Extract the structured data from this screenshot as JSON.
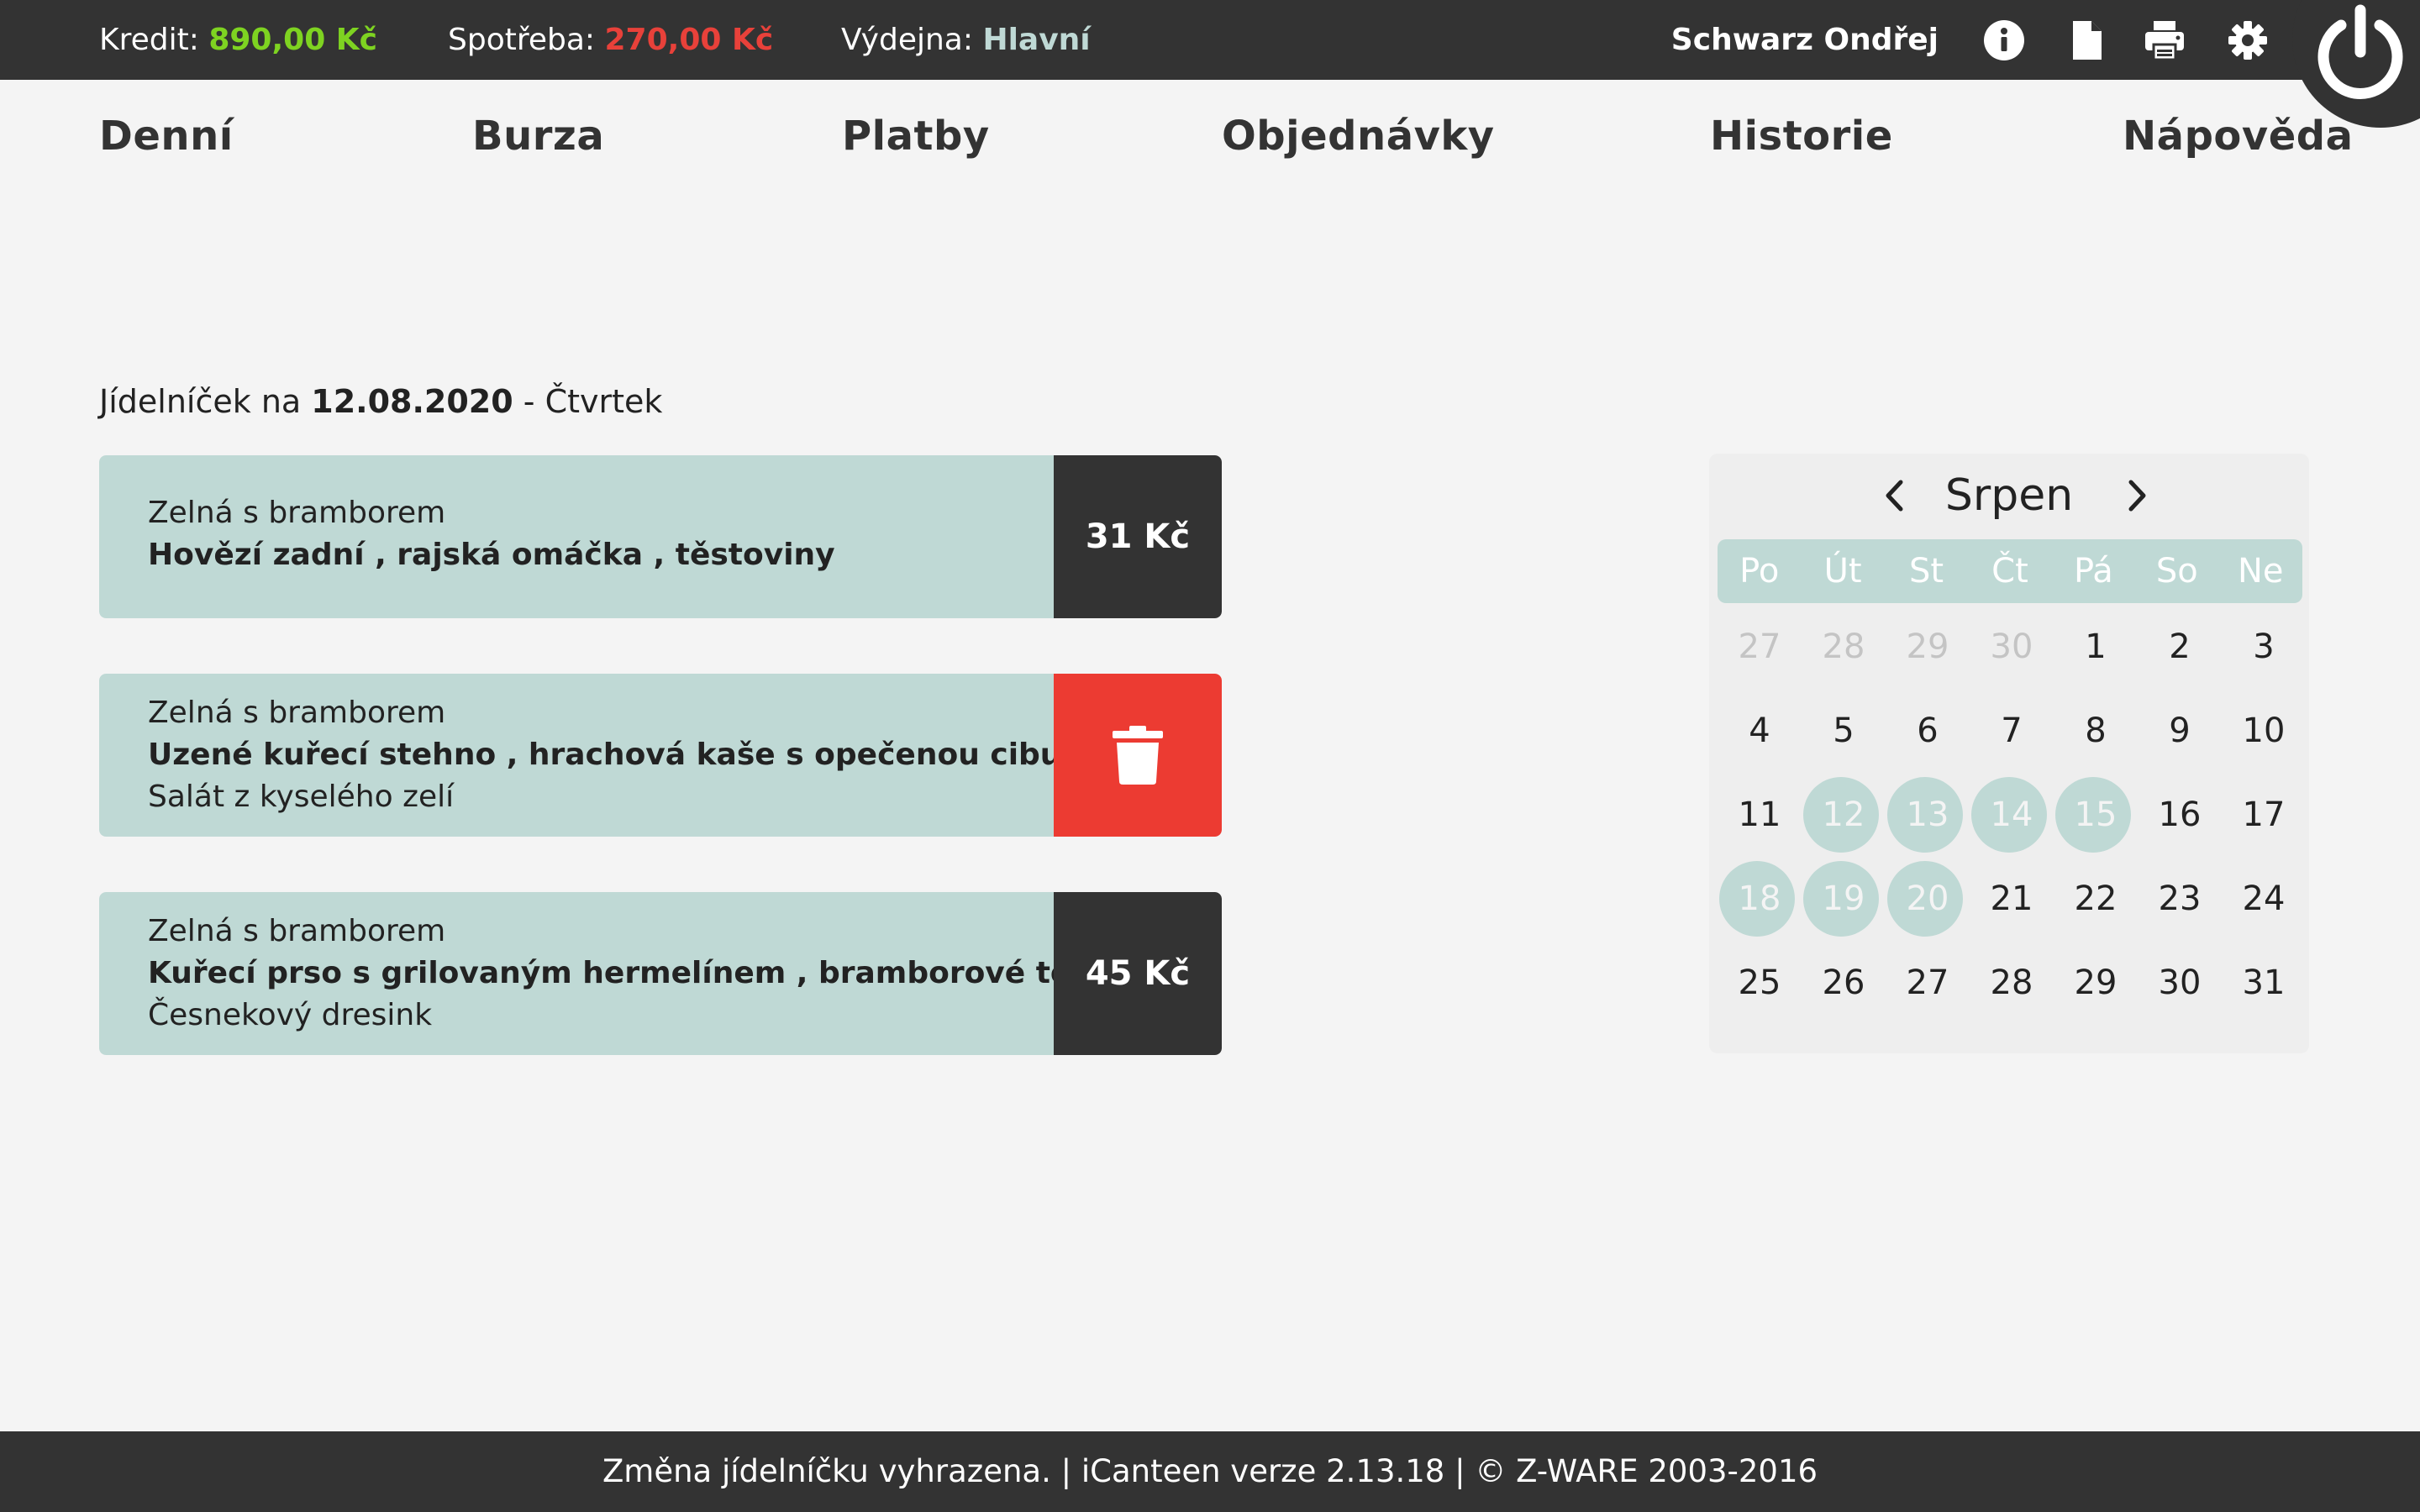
{
  "topbar": {
    "credit_label": "Kredit:",
    "credit_value": "890,00 Kč",
    "spend_label": "Spotřeba:",
    "spend_value": "270,00 Kč",
    "canteen_label": "Výdejna:",
    "canteen_value": "Hlavní",
    "user_name": "Schwarz Ondřej",
    "icons": [
      "info-icon",
      "document-icon",
      "print-icon",
      "gear-icon",
      "power-icon"
    ],
    "colors": {
      "credit": "#7ed321",
      "spend": "#e8413a",
      "canteen": "#bfd9d5",
      "bar": "#333333"
    }
  },
  "nav": {
    "items": [
      {
        "label": "Denní"
      },
      {
        "label": "Burza"
      },
      {
        "label": "Platby"
      },
      {
        "label": "Objednávky"
      },
      {
        "label": "Historie"
      },
      {
        "label": "Nápověda"
      }
    ]
  },
  "menu": {
    "heading_prefix": "Jídelníček na",
    "date": "12.08.2020",
    "heading_suffix": "- Čtvrtek",
    "meals": [
      {
        "soup": "Zelná s bramborem",
        "main": "Hovězí zadní , rajská omáčka , těstoviny",
        "side": "",
        "action": "31 Kč",
        "action_type": "price"
      },
      {
        "soup": "Zelná s bramborem",
        "main": "Uzené kuřecí stehno , hrachová kaše s opečenou cibulkou",
        "side": "Salát z kyselého zelí",
        "action": "",
        "action_type": "delete"
      },
      {
        "soup": "Zelná s bramborem",
        "main": "Kuřecí prso s grilovaným hermelínem , bramborové tolárky",
        "side": "Česnekový dresink",
        "action": "45 Kč",
        "action_type": "price"
      }
    ],
    "colors": {
      "card": "#bfd9d5",
      "price_bg": "#333333",
      "delete_bg": "#ec3b32"
    }
  },
  "calendar": {
    "month": "Srpen",
    "weekdays": [
      "Po",
      "Út",
      "St",
      "Čt",
      "Pá",
      "So",
      "Ne"
    ],
    "weeks": [
      [
        {
          "d": "27",
          "muted": true
        },
        {
          "d": "28",
          "muted": true
        },
        {
          "d": "29",
          "muted": true
        },
        {
          "d": "30",
          "muted": true
        },
        {
          "d": "1"
        },
        {
          "d": "2"
        },
        {
          "d": "3"
        }
      ],
      [
        {
          "d": "4"
        },
        {
          "d": "5"
        },
        {
          "d": "6"
        },
        {
          "d": "7"
        },
        {
          "d": "8"
        },
        {
          "d": "9"
        },
        {
          "d": "10"
        }
      ],
      [
        {
          "d": "11"
        },
        {
          "d": "12",
          "hl": true
        },
        {
          "d": "13",
          "hl": true
        },
        {
          "d": "14",
          "hl": true
        },
        {
          "d": "15",
          "hl": true
        },
        {
          "d": "16"
        },
        {
          "d": "17"
        }
      ],
      [
        {
          "d": "18",
          "hl": true
        },
        {
          "d": "19",
          "hl": true
        },
        {
          "d": "20",
          "hl": true
        },
        {
          "d": "21"
        },
        {
          "d": "22"
        },
        {
          "d": "23"
        },
        {
          "d": "24"
        }
      ],
      [
        {
          "d": "25"
        },
        {
          "d": "26"
        },
        {
          "d": "27"
        },
        {
          "d": "28"
        },
        {
          "d": "29"
        },
        {
          "d": "30"
        },
        {
          "d": "31"
        }
      ]
    ]
  },
  "footer": {
    "text": "Změna jídelníčku vyhrazena. | iCanteen verze 2.13.18 | © Z-WARE 2003-2016"
  }
}
